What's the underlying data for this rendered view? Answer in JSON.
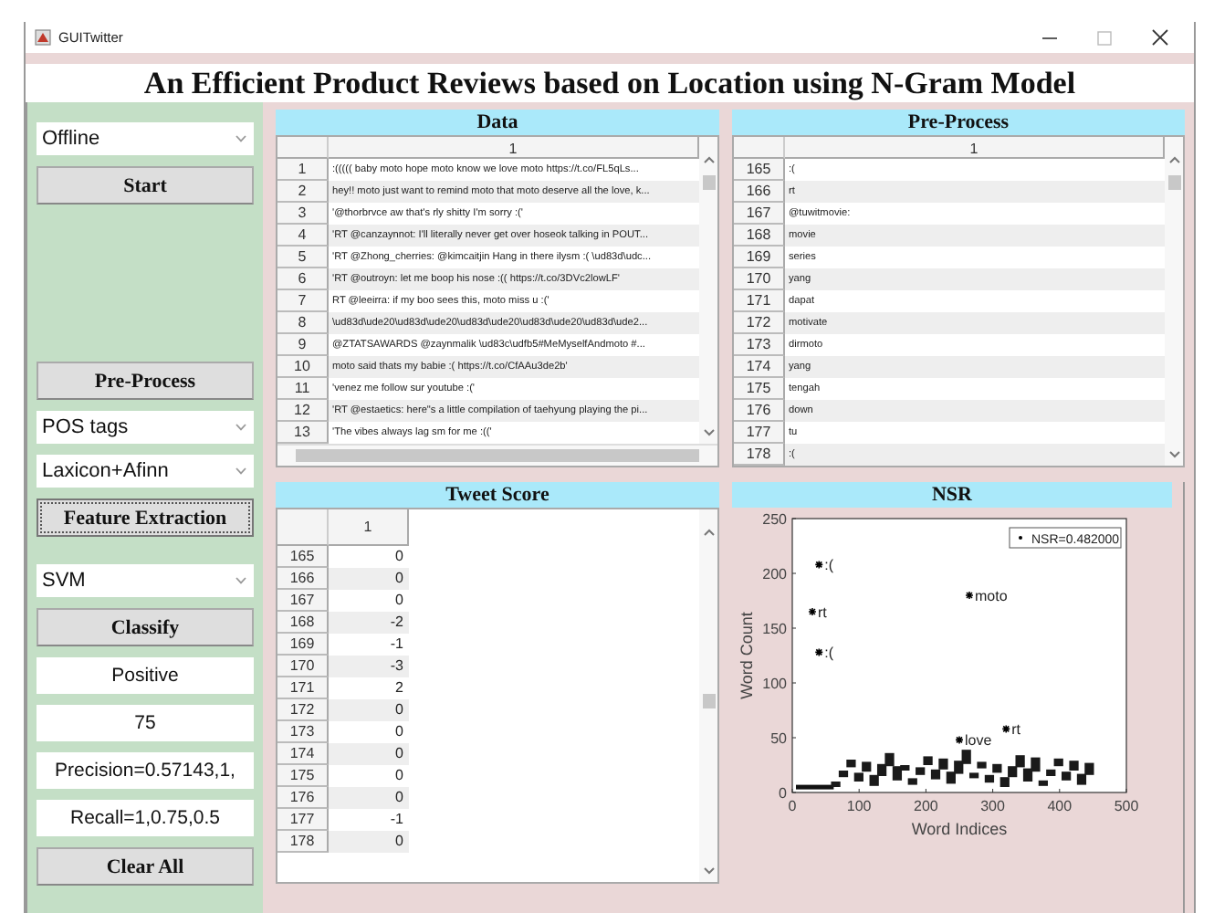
{
  "window": {
    "title": "GUITwitter"
  },
  "heading": "An Efficient Product Reviews based on Location using N-Gram Model",
  "sidebar": {
    "groups": [
      [
        {
          "kind": "dropdown",
          "value": "Offline"
        },
        {
          "kind": "button",
          "label": "Start",
          "focused": false
        }
      ],
      [
        {
          "kind": "button",
          "label": "Pre-Process",
          "focused": false
        },
        {
          "kind": "dropdown",
          "value": "POS tags"
        },
        {
          "kind": "dropdown",
          "value": "Laxicon+Afinn"
        },
        {
          "kind": "button",
          "label": "Feature Extraction",
          "focused": true
        }
      ],
      [
        {
          "kind": "dropdown",
          "value": "SVM"
        },
        {
          "kind": "button",
          "label": "Classify",
          "focused": false
        },
        {
          "kind": "output",
          "value": "Positive"
        },
        {
          "kind": "output",
          "value": "75"
        },
        {
          "kind": "output",
          "value": "Precision=0.57143,1,"
        },
        {
          "kind": "output",
          "value": "Recall=1,0.75,0.5"
        },
        {
          "kind": "button",
          "label": "Clear All",
          "focused": false
        }
      ]
    ]
  },
  "panels": [
    {
      "title": "Data",
      "kind": "text_table",
      "hscroll": true,
      "column": "1",
      "rows": [
        {
          "index": "1",
          "cell": ":((((( baby moto hope moto know we love moto https://t.co/FL5qLs..."
        },
        {
          "index": "2",
          "cell": "hey!! moto just want to remind moto that moto deserve all the love, k..."
        },
        {
          "index": "3",
          "cell": "'@thorbrvce aw that's rly shitty I'm sorry :('"
        },
        {
          "index": "4",
          "cell": "'RT @canzaynnot: I'll literally never get over hoseok talking in POUT..."
        },
        {
          "index": "5",
          "cell": "'RT @Zhong_cherries: @kimcaitjin Hang in there ilysm :( \\ud83d\\udc..."
        },
        {
          "index": "6",
          "cell": "'RT @outroyn: let me boop his nose :(( https://t.co/3DVc2lowLF'"
        },
        {
          "index": "7",
          "cell": "RT @leeirra: if my boo sees this, moto miss u :('"
        },
        {
          "index": "8",
          "cell": "\\ud83d\\ude20\\ud83d\\ude20\\ud83d\\ude20\\ud83d\\ude20\\ud83d\\ude2..."
        },
        {
          "index": "9",
          "cell": "@ZTATSAWARDS @zaynmalik \\ud83c\\udfb5#MeMyselfAndmoto #..."
        },
        {
          "index": "10",
          "cell": "moto said thats my babie :( https://t.co/CfAAu3de2b'"
        },
        {
          "index": "11",
          "cell": "'venez me follow sur youtube :('"
        },
        {
          "index": "12",
          "cell": "'RT @estaetics: here\"s a little compilation of taehyung playing the pi..."
        },
        {
          "index": "13",
          "cell": "'The vibes always lag sm for me :(('"
        }
      ]
    },
    {
      "title": "Pre-Process",
      "kind": "text_table",
      "hscroll": false,
      "column": "1",
      "rows": [
        {
          "index": "165",
          "cell": ":("
        },
        {
          "index": "166",
          "cell": "rt"
        },
        {
          "index": "167",
          "cell": "@tuwitmovie:"
        },
        {
          "index": "168",
          "cell": "movie"
        },
        {
          "index": "169",
          "cell": "series"
        },
        {
          "index": "170",
          "cell": "yang"
        },
        {
          "index": "171",
          "cell": "dapat"
        },
        {
          "index": "172",
          "cell": "motivate"
        },
        {
          "index": "173",
          "cell": "dirmoto"
        },
        {
          "index": "174",
          "cell": "yang"
        },
        {
          "index": "175",
          "cell": "tengah"
        },
        {
          "index": "176",
          "cell": "down"
        },
        {
          "index": "177",
          "cell": "tu"
        },
        {
          "index": "178",
          "cell": ":("
        }
      ]
    },
    {
      "title": "Tweet Score",
      "kind": "number_table",
      "hscroll": false,
      "column": "1",
      "rows": [
        {
          "index": "165",
          "cell": "0"
        },
        {
          "index": "166",
          "cell": "0"
        },
        {
          "index": "167",
          "cell": "0"
        },
        {
          "index": "168",
          "cell": "-2"
        },
        {
          "index": "169",
          "cell": "-1"
        },
        {
          "index": "170",
          "cell": "-3"
        },
        {
          "index": "171",
          "cell": "2"
        },
        {
          "index": "172",
          "cell": "0"
        },
        {
          "index": "173",
          "cell": "0"
        },
        {
          "index": "174",
          "cell": "0"
        },
        {
          "index": "175",
          "cell": "0"
        },
        {
          "index": "176",
          "cell": "0"
        },
        {
          "index": "177",
          "cell": "-1"
        },
        {
          "index": "178",
          "cell": "0"
        }
      ]
    },
    {
      "title": "NSR",
      "kind": "chart",
      "chart_data": {
        "type": "scatter",
        "xlabel": "Word Indices",
        "ylabel": "Word Count",
        "xlim": [
          0,
          500
        ],
        "ylim": [
          0,
          250
        ],
        "xticks": [
          0,
          100,
          200,
          300,
          400,
          500
        ],
        "yticks": [
          0,
          50,
          100,
          150,
          200,
          250
        ],
        "series": [
          {
            "name": "NSR=0.482000",
            "color": "#000000",
            "x": [
              40,
              30,
              40,
              265,
              250,
              320
            ],
            "values": [
              208,
              165,
              128,
              180,
              48,
              58
            ]
          }
        ],
        "annotations": [
          {
            "x": 40,
            "y": 208,
            "text": ":("
          },
          {
            "x": 30,
            "y": 165,
            "text": "rt"
          },
          {
            "x": 40,
            "y": 128,
            "text": ":("
          },
          {
            "x": 265,
            "y": 180,
            "text": "moto"
          },
          {
            "x": 250,
            "y": 48,
            "text": "love"
          },
          {
            "x": 320,
            "y": 58,
            "text": "rt"
          }
        ]
      }
    }
  ]
}
